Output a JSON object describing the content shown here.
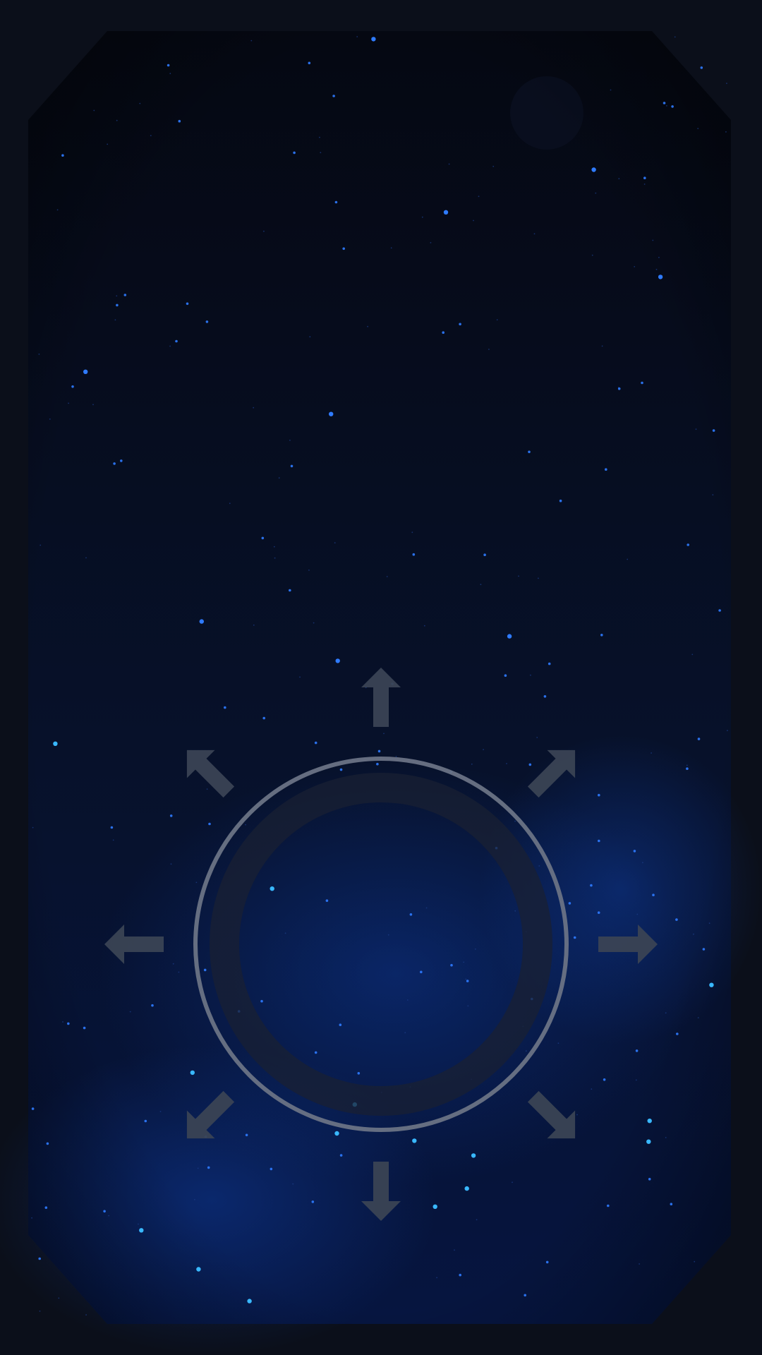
{
  "scene": {
    "background_color": "#0b0f1a",
    "panel_color": "#060a16",
    "nebula_color": "#0a2a6e",
    "star_color": "#2f7bff",
    "star_bright_color": "#39b8ff"
  },
  "joystick": {
    "ring_color": "#6a7385",
    "arrow_color": "#3a4354",
    "directions": [
      "up",
      "up-right",
      "right",
      "down-right",
      "down",
      "down-left",
      "left",
      "up-left"
    ]
  }
}
